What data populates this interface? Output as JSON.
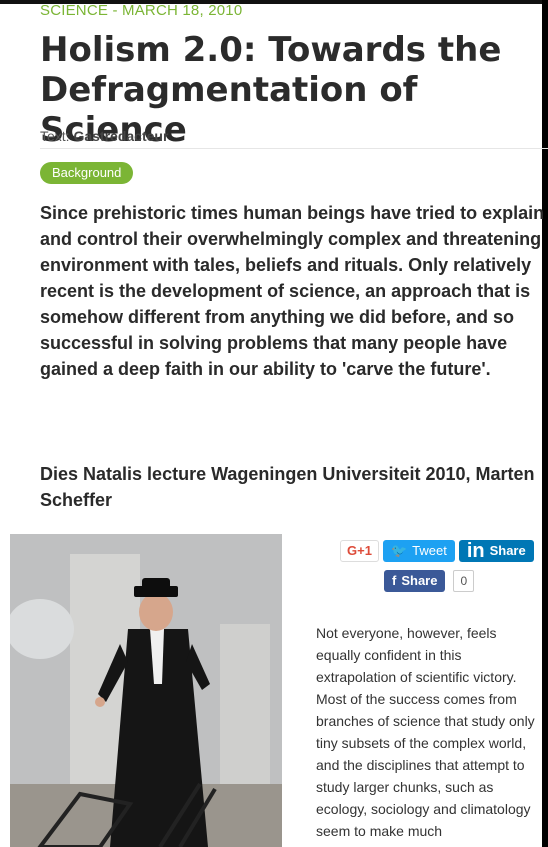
{
  "article": {
    "meta": "SCIENCE - MARCH 18, 2010",
    "title": "Holism 2.0: Towards the Defragmentation of Science",
    "byline_label": "Text:",
    "byline_author": "Gastredacteur",
    "category_badge": "Background",
    "lead": "Since prehistoric times human beings have tried to explain and control their overwhelmingly complex and threatening environment with tales, beliefs and rituals. Only relatively recent is the development of science, an approach that is somehow different from anything we did before, and so successful in solving problems that many people have gained a deep faith in our ability to 'carve the future'.",
    "lecture": "Dies Natalis lecture Wageningen Universiteit 2010, Marten Scheffer",
    "body": "Not everyone, however, feels equally confident in this extrapolation of scientific victory. Most of the success comes from branches of science that study only tiny subsets of the complex world, and the disciplines that attempt to study larger chunks, such as ecology, sociology and climatology seem to make much"
  },
  "share": {
    "google_label": "G+1",
    "tweet_label": "Tweet",
    "linkedin_glyph": "in",
    "linkedin_label": "Share",
    "facebook_label": "Share",
    "facebook_count": "0"
  },
  "colors": {
    "accent_green": "#7bb535",
    "twitter": "#1da1f2",
    "linkedin": "#0077b5",
    "facebook": "#3b5998"
  },
  "icons": [
    "twitter-bird-icon",
    "linkedin-icon",
    "facebook-icon"
  ]
}
